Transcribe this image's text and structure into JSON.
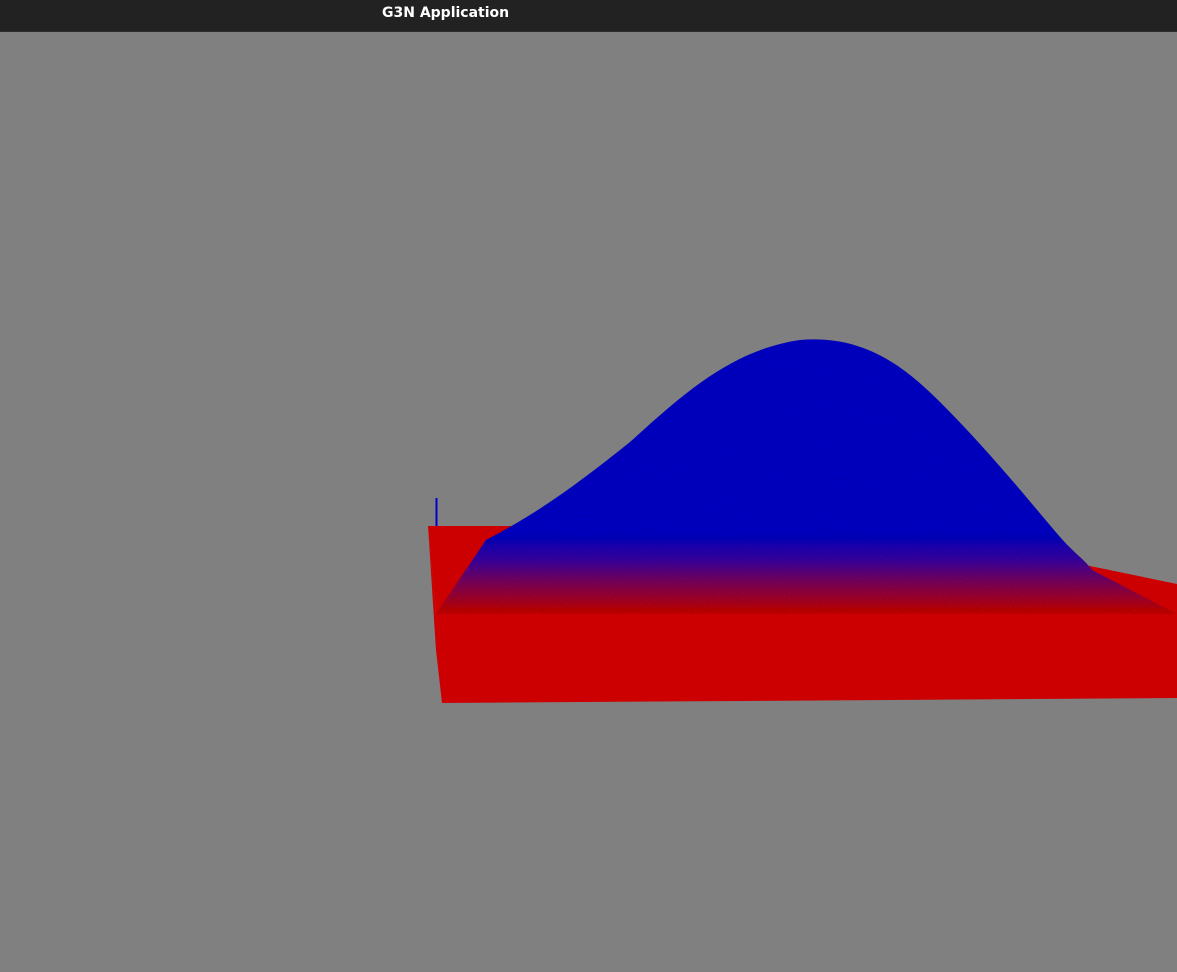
{
  "window": {
    "title": "G3N Application"
  },
  "scene": {
    "background_color": "#808080",
    "surface_low_color": "#cc0000",
    "surface_high_color": "#0000cc",
    "axis_color": "#0000cc",
    "surface_shape": "gaussian-bump",
    "objects": [
      "heightmap-surface",
      "axis-line"
    ]
  }
}
